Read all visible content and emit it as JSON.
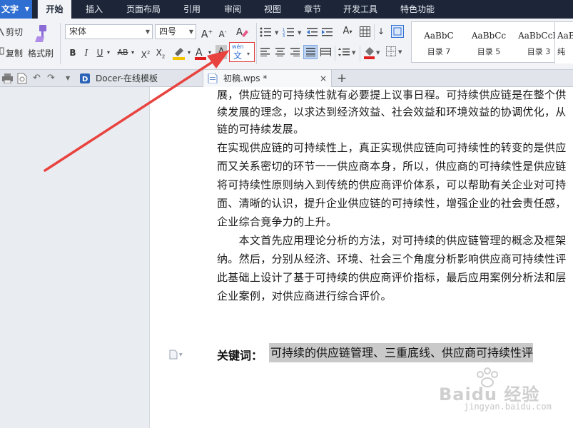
{
  "menu": {
    "app_label": "文字",
    "tabs": [
      "开始",
      "插入",
      "页面布局",
      "引用",
      "审阅",
      "视图",
      "章节",
      "开发工具",
      "特色功能"
    ]
  },
  "ribbon": {
    "cut_label": "剪切",
    "copy_label": "复制",
    "format_painter_label": "格式刷",
    "font_name": "宋体",
    "font_size": "四号",
    "phonetic_guide": {
      "top": "wén",
      "bottom": "文"
    },
    "styles": [
      {
        "sample": "AaBbC",
        "name": "目录 7"
      },
      {
        "sample": "AaBbCc",
        "name": "目录 5"
      },
      {
        "sample": "AaBbCcD",
        "name": "目录 3"
      },
      {
        "sample": "AaBb",
        "name": "纯"
      }
    ]
  },
  "tabs": {
    "docer_label": "Docer-在线模板",
    "doc_label": "初稿.wps *",
    "close_glyph": "×",
    "add_glyph": "+"
  },
  "document": {
    "lines": [
      "展，供应链的可持续性就有必要提上议事日程。可持续供应链是在整个供",
      "续发展的理念，以求达到经济效益、社会效益和环境效益的协调优化，从",
      "链的可持续发展。",
      "在实现供应链的可持续性上，真正实现供应链向可持续性的转变的是供应",
      "而又关系密切的环节一一供应商本身，所以，供应商的可持续性是供应链",
      "将可持续性原则纳入到传统的供应商评价体系，可以帮助有关企业对可持",
      "面、清晰的认识，提升企业供应链的可持续性，增强企业的社会责任感，",
      "企业综合竞争力的上升。",
      "　　本文首先应用理论分析的方法，对可持续的供应链管理的概念及框架",
      "纳。然后，分别从经济、环境、社会三个角度分析影响供应商可持续性评",
      "此基础上设计了基于可持续的供应商评价指标，最后应用案例分析法和层",
      "企业案例，对供应商进行综合评价。"
    ],
    "keywords_label": "关键词：",
    "keywords_text": "可持续的供应链管理、三重底线、供应商可持续性评"
  },
  "watermark": {
    "brand": "Baidu 经验",
    "url": "jingyan.baidu.com"
  },
  "colors": {
    "accent": "#2f6fd1",
    "menubar": "#1d2638",
    "arrow": "#e8433f",
    "highlight": "#c9c9c9"
  }
}
